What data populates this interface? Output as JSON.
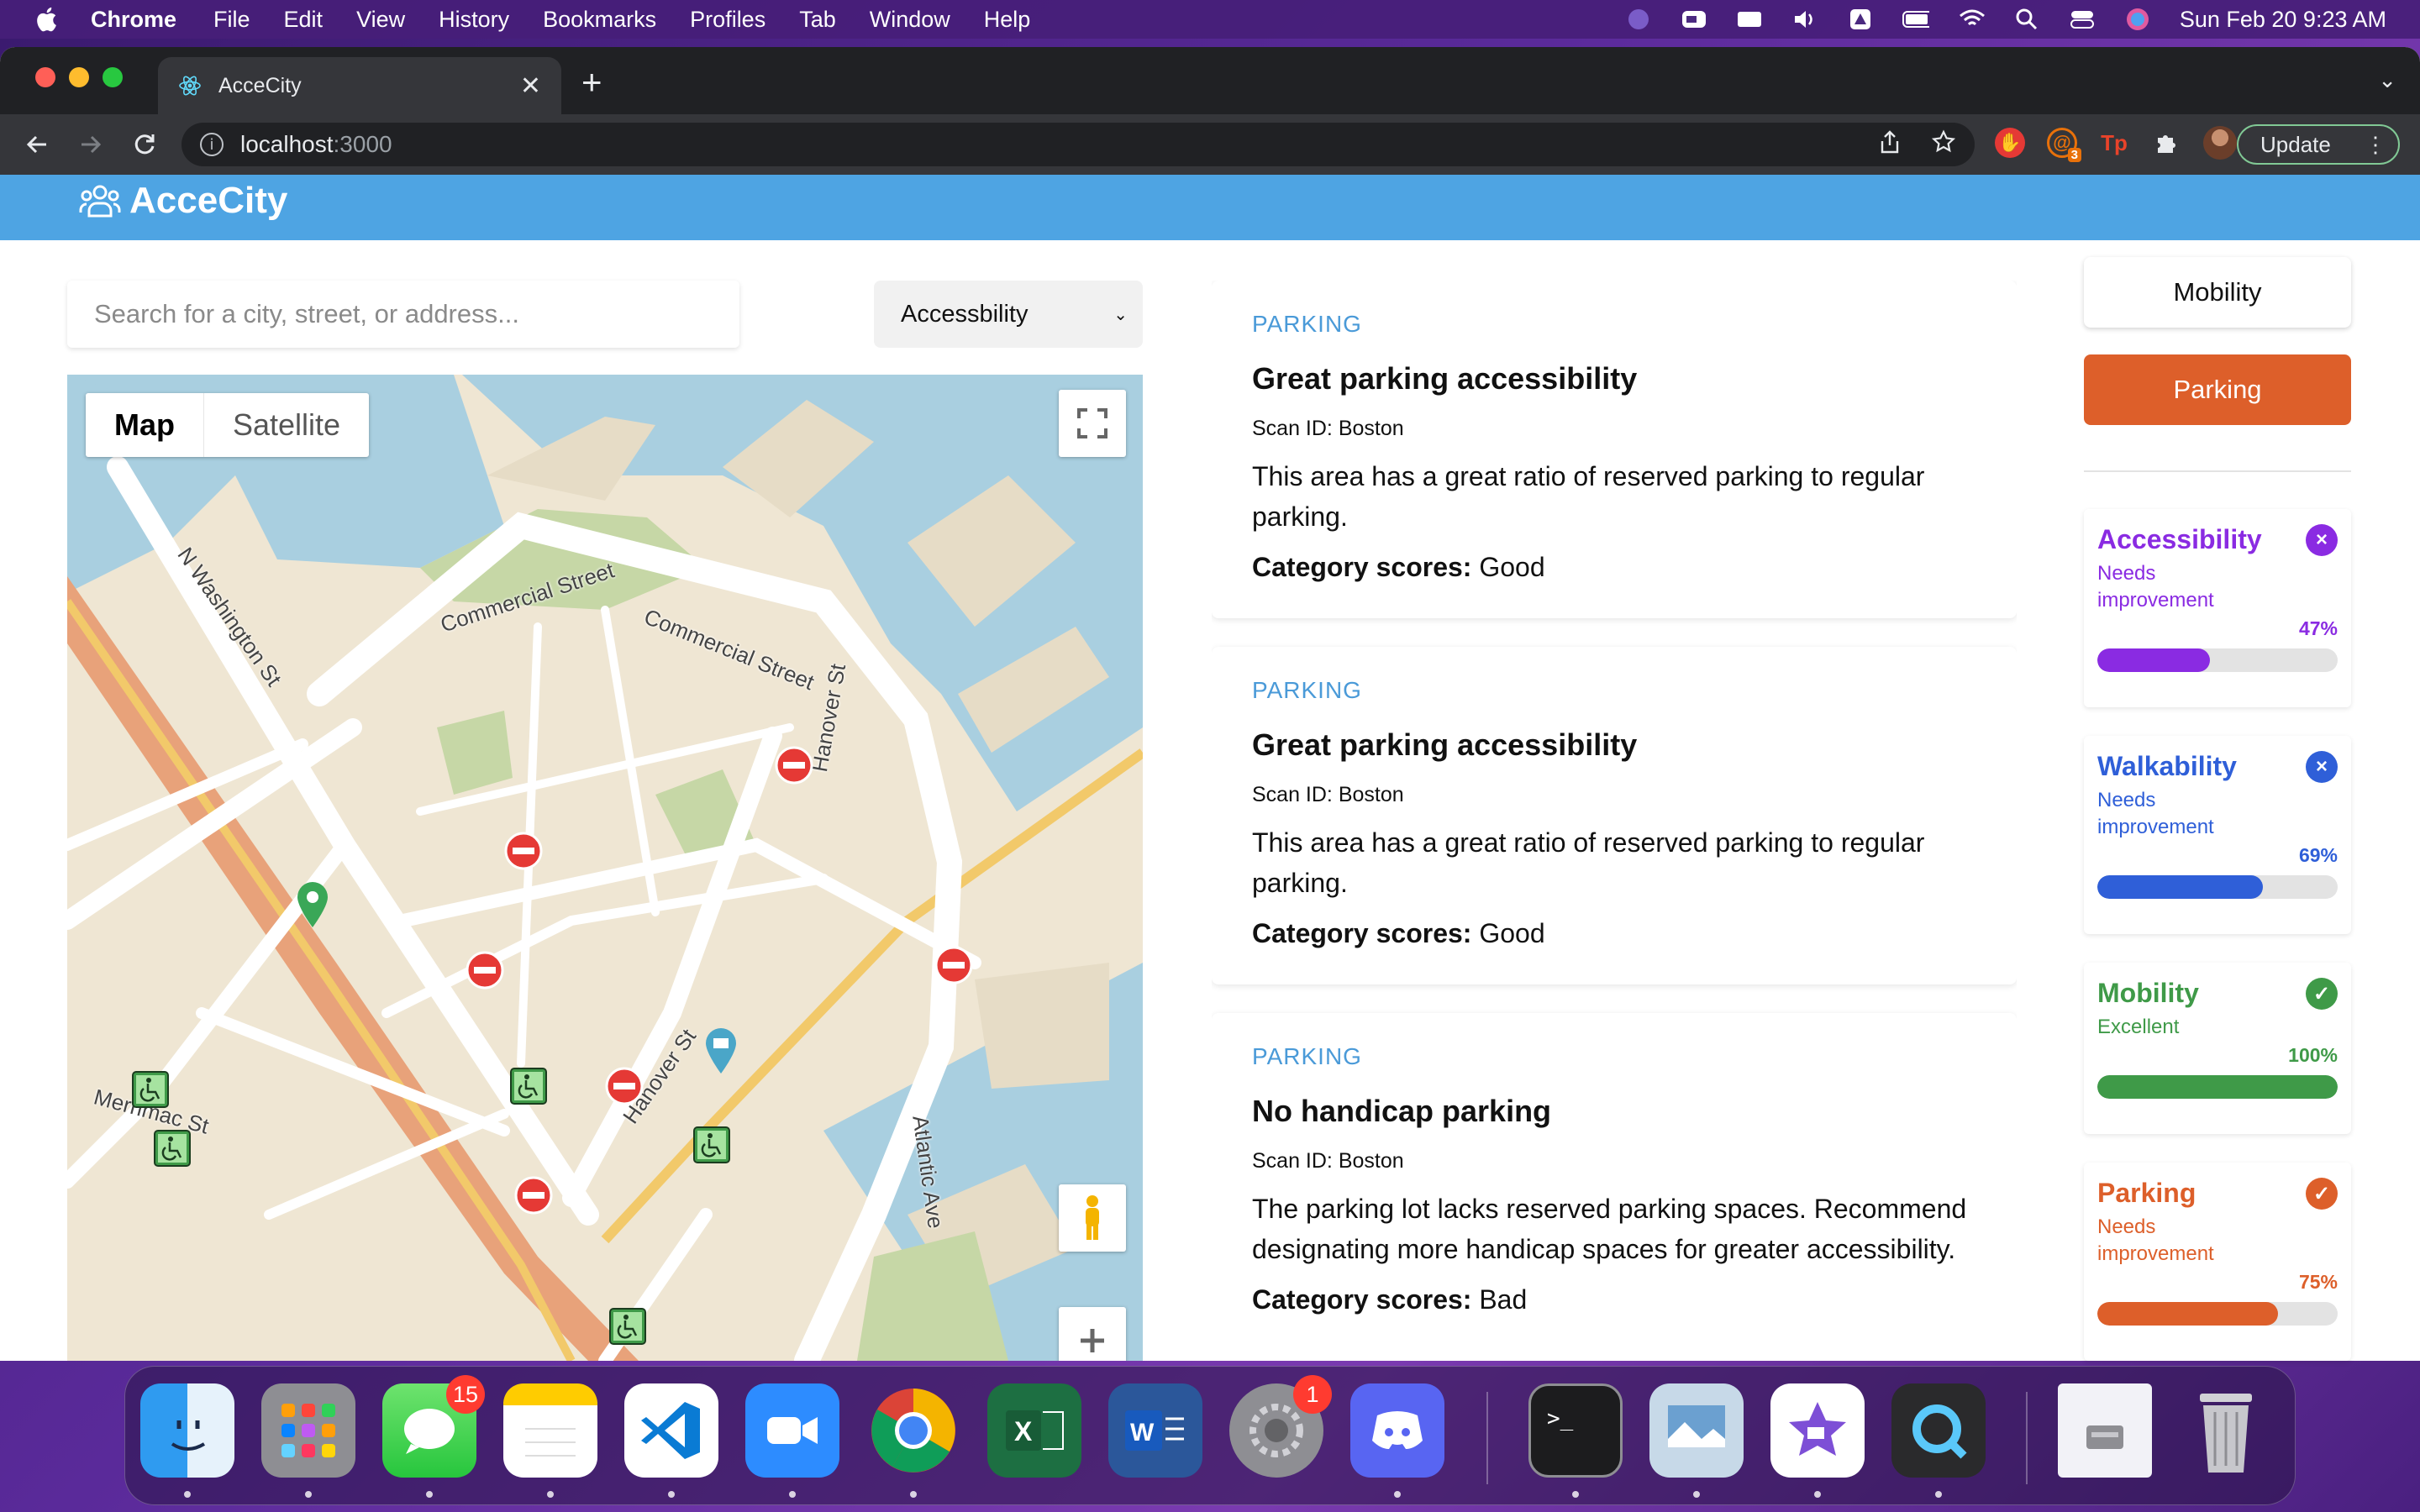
{
  "menubar": {
    "app_name": "Chrome",
    "items": [
      "File",
      "Edit",
      "View",
      "History",
      "Bookmarks",
      "Profiles",
      "Tab",
      "Window",
      "Help"
    ],
    "clock": "Sun Feb 20  9:23 AM"
  },
  "browser": {
    "tab_title": "AcceCity",
    "url_host": "localhost",
    "url_port": ":3000",
    "update_label": "Update",
    "extension_badge": "3"
  },
  "app": {
    "brand": "AcceCity",
    "search_placeholder": "Search for a city, street, or address...",
    "filter_selected": "Accessbility",
    "map": {
      "type_map": "Map",
      "type_satellite": "Satellite",
      "streets": [
        "N Washington St",
        "Commercial Street",
        "Commercial Street",
        "Hanover St",
        "Atlantic Ave",
        "Hanover St",
        "Merrimac St"
      ]
    },
    "cards": [
      {
        "category": "PARKING",
        "title": "Great parking accessibility",
        "scan_id": "Scan ID: Boston",
        "description": "This area has a great ratio of reserved parking to regular parking.",
        "score_label": "Category scores:",
        "score_value": "Good"
      },
      {
        "category": "PARKING",
        "title": "Great parking accessibility",
        "scan_id": "Scan ID: Boston",
        "description": "This area has a great ratio of reserved parking to regular parking.",
        "score_label": "Category scores:",
        "score_value": "Good"
      },
      {
        "category": "PARKING",
        "title": "No handicap parking",
        "scan_id": "Scan ID: Boston",
        "description": "The parking lot lacks reserved parking spaces. Recommend designating more handicap spaces for greater accessibility.",
        "score_label": "Category scores:",
        "score_value": "Bad"
      }
    ],
    "sidebar": {
      "mobility_button": "Mobility",
      "parking_button": "Parking",
      "scores": [
        {
          "name": "Accessibility",
          "status": "Needs improvement",
          "percent": "47%",
          "value": 47,
          "color": "#8a2be2",
          "icon": "close-icon"
        },
        {
          "name": "Walkability",
          "status": "Needs improvement",
          "percent": "69%",
          "value": 69,
          "color": "#2f5fd8",
          "icon": "close-icon"
        },
        {
          "name": "Mobility",
          "status": "Excellent",
          "percent": "100%",
          "value": 100,
          "color": "#3f9a48",
          "icon": "check-icon"
        },
        {
          "name": "Parking",
          "status": "Needs improvement",
          "percent": "75%",
          "value": 75,
          "color": "#dd5f2a",
          "icon": "check-icon"
        }
      ]
    }
  },
  "dock": {
    "messages_badge": "15",
    "settings_badge": "1"
  }
}
